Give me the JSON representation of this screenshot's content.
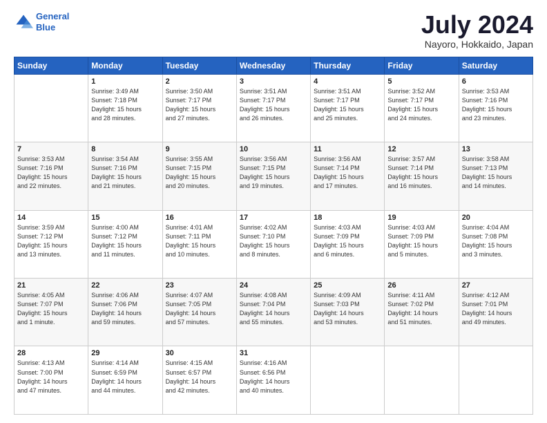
{
  "logo": {
    "line1": "General",
    "line2": "Blue"
  },
  "title": "July 2024",
  "subtitle": "Nayoro, Hokkaido, Japan",
  "header": {
    "days": [
      "Sunday",
      "Monday",
      "Tuesday",
      "Wednesday",
      "Thursday",
      "Friday",
      "Saturday"
    ]
  },
  "weeks": [
    [
      {
        "day": "",
        "info": ""
      },
      {
        "day": "1",
        "info": "Sunrise: 3:49 AM\nSunset: 7:18 PM\nDaylight: 15 hours\nand 28 minutes."
      },
      {
        "day": "2",
        "info": "Sunrise: 3:50 AM\nSunset: 7:17 PM\nDaylight: 15 hours\nand 27 minutes."
      },
      {
        "day": "3",
        "info": "Sunrise: 3:51 AM\nSunset: 7:17 PM\nDaylight: 15 hours\nand 26 minutes."
      },
      {
        "day": "4",
        "info": "Sunrise: 3:51 AM\nSunset: 7:17 PM\nDaylight: 15 hours\nand 25 minutes."
      },
      {
        "day": "5",
        "info": "Sunrise: 3:52 AM\nSunset: 7:17 PM\nDaylight: 15 hours\nand 24 minutes."
      },
      {
        "day": "6",
        "info": "Sunrise: 3:53 AM\nSunset: 7:16 PM\nDaylight: 15 hours\nand 23 minutes."
      }
    ],
    [
      {
        "day": "7",
        "info": "Sunrise: 3:53 AM\nSunset: 7:16 PM\nDaylight: 15 hours\nand 22 minutes."
      },
      {
        "day": "8",
        "info": "Sunrise: 3:54 AM\nSunset: 7:16 PM\nDaylight: 15 hours\nand 21 minutes."
      },
      {
        "day": "9",
        "info": "Sunrise: 3:55 AM\nSunset: 7:15 PM\nDaylight: 15 hours\nand 20 minutes."
      },
      {
        "day": "10",
        "info": "Sunrise: 3:56 AM\nSunset: 7:15 PM\nDaylight: 15 hours\nand 19 minutes."
      },
      {
        "day": "11",
        "info": "Sunrise: 3:56 AM\nSunset: 7:14 PM\nDaylight: 15 hours\nand 17 minutes."
      },
      {
        "day": "12",
        "info": "Sunrise: 3:57 AM\nSunset: 7:14 PM\nDaylight: 15 hours\nand 16 minutes."
      },
      {
        "day": "13",
        "info": "Sunrise: 3:58 AM\nSunset: 7:13 PM\nDaylight: 15 hours\nand 14 minutes."
      }
    ],
    [
      {
        "day": "14",
        "info": "Sunrise: 3:59 AM\nSunset: 7:12 PM\nDaylight: 15 hours\nand 13 minutes."
      },
      {
        "day": "15",
        "info": "Sunrise: 4:00 AM\nSunset: 7:12 PM\nDaylight: 15 hours\nand 11 minutes."
      },
      {
        "day": "16",
        "info": "Sunrise: 4:01 AM\nSunset: 7:11 PM\nDaylight: 15 hours\nand 10 minutes."
      },
      {
        "day": "17",
        "info": "Sunrise: 4:02 AM\nSunset: 7:10 PM\nDaylight: 15 hours\nand 8 minutes."
      },
      {
        "day": "18",
        "info": "Sunrise: 4:03 AM\nSunset: 7:09 PM\nDaylight: 15 hours\nand 6 minutes."
      },
      {
        "day": "19",
        "info": "Sunrise: 4:03 AM\nSunset: 7:09 PM\nDaylight: 15 hours\nand 5 minutes."
      },
      {
        "day": "20",
        "info": "Sunrise: 4:04 AM\nSunset: 7:08 PM\nDaylight: 15 hours\nand 3 minutes."
      }
    ],
    [
      {
        "day": "21",
        "info": "Sunrise: 4:05 AM\nSunset: 7:07 PM\nDaylight: 15 hours\nand 1 minute."
      },
      {
        "day": "22",
        "info": "Sunrise: 4:06 AM\nSunset: 7:06 PM\nDaylight: 14 hours\nand 59 minutes."
      },
      {
        "day": "23",
        "info": "Sunrise: 4:07 AM\nSunset: 7:05 PM\nDaylight: 14 hours\nand 57 minutes."
      },
      {
        "day": "24",
        "info": "Sunrise: 4:08 AM\nSunset: 7:04 PM\nDaylight: 14 hours\nand 55 minutes."
      },
      {
        "day": "25",
        "info": "Sunrise: 4:09 AM\nSunset: 7:03 PM\nDaylight: 14 hours\nand 53 minutes."
      },
      {
        "day": "26",
        "info": "Sunrise: 4:11 AM\nSunset: 7:02 PM\nDaylight: 14 hours\nand 51 minutes."
      },
      {
        "day": "27",
        "info": "Sunrise: 4:12 AM\nSunset: 7:01 PM\nDaylight: 14 hours\nand 49 minutes."
      }
    ],
    [
      {
        "day": "28",
        "info": "Sunrise: 4:13 AM\nSunset: 7:00 PM\nDaylight: 14 hours\nand 47 minutes."
      },
      {
        "day": "29",
        "info": "Sunrise: 4:14 AM\nSunset: 6:59 PM\nDaylight: 14 hours\nand 44 minutes."
      },
      {
        "day": "30",
        "info": "Sunrise: 4:15 AM\nSunset: 6:57 PM\nDaylight: 14 hours\nand 42 minutes."
      },
      {
        "day": "31",
        "info": "Sunrise: 4:16 AM\nSunset: 6:56 PM\nDaylight: 14 hours\nand 40 minutes."
      },
      {
        "day": "",
        "info": ""
      },
      {
        "day": "",
        "info": ""
      },
      {
        "day": "",
        "info": ""
      }
    ]
  ]
}
